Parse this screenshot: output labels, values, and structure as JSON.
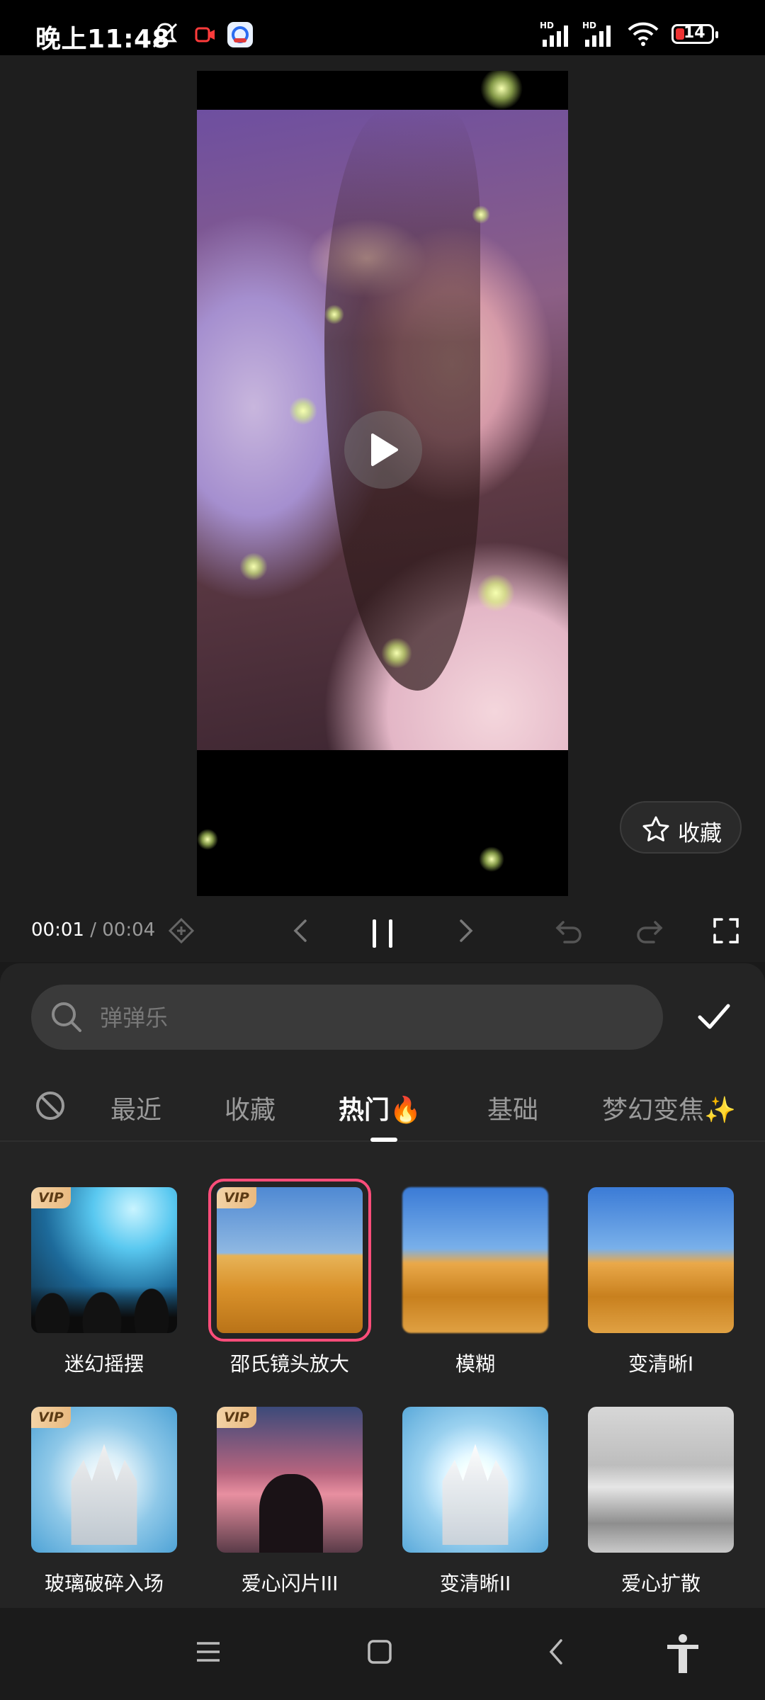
{
  "status_bar": {
    "time": "晚上11:48",
    "battery": "14",
    "network_label": "HD"
  },
  "preview": {
    "favorite_label": "收藏"
  },
  "transport": {
    "current_time": "00:01",
    "separator": " / ",
    "total_time": "00:04"
  },
  "search": {
    "placeholder": "弹弹乐"
  },
  "tabs": [
    {
      "label": "最近"
    },
    {
      "label": "收藏"
    },
    {
      "label": "热门🔥",
      "active": true
    },
    {
      "label": "基础"
    },
    {
      "label": "梦幻变焦✨"
    }
  ],
  "effects": [
    {
      "name": "迷幻摇摆",
      "vip": true,
      "thumb": "concert"
    },
    {
      "name": "邵氏镜头放大",
      "vip": true,
      "thumb": "desert",
      "selected": true
    },
    {
      "name": "模糊",
      "vip": false,
      "thumb": "desert-blur"
    },
    {
      "name": "变清晰I",
      "vip": false,
      "thumb": "desert-blur"
    },
    {
      "name": "玻璃破碎入场",
      "vip": true,
      "thumb": "castle"
    },
    {
      "name": "爱心闪片III",
      "vip": true,
      "thumb": "kiss"
    },
    {
      "name": "变清晰II",
      "vip": false,
      "thumb": "castle"
    },
    {
      "name": "爱心扩散",
      "vip": false,
      "thumb": "bw-desert"
    }
  ],
  "vip_label": "VIP",
  "colors": {
    "accent_selected": "#ff4d7a",
    "panel_bg": "#242424",
    "battery_low": "#e33333"
  }
}
